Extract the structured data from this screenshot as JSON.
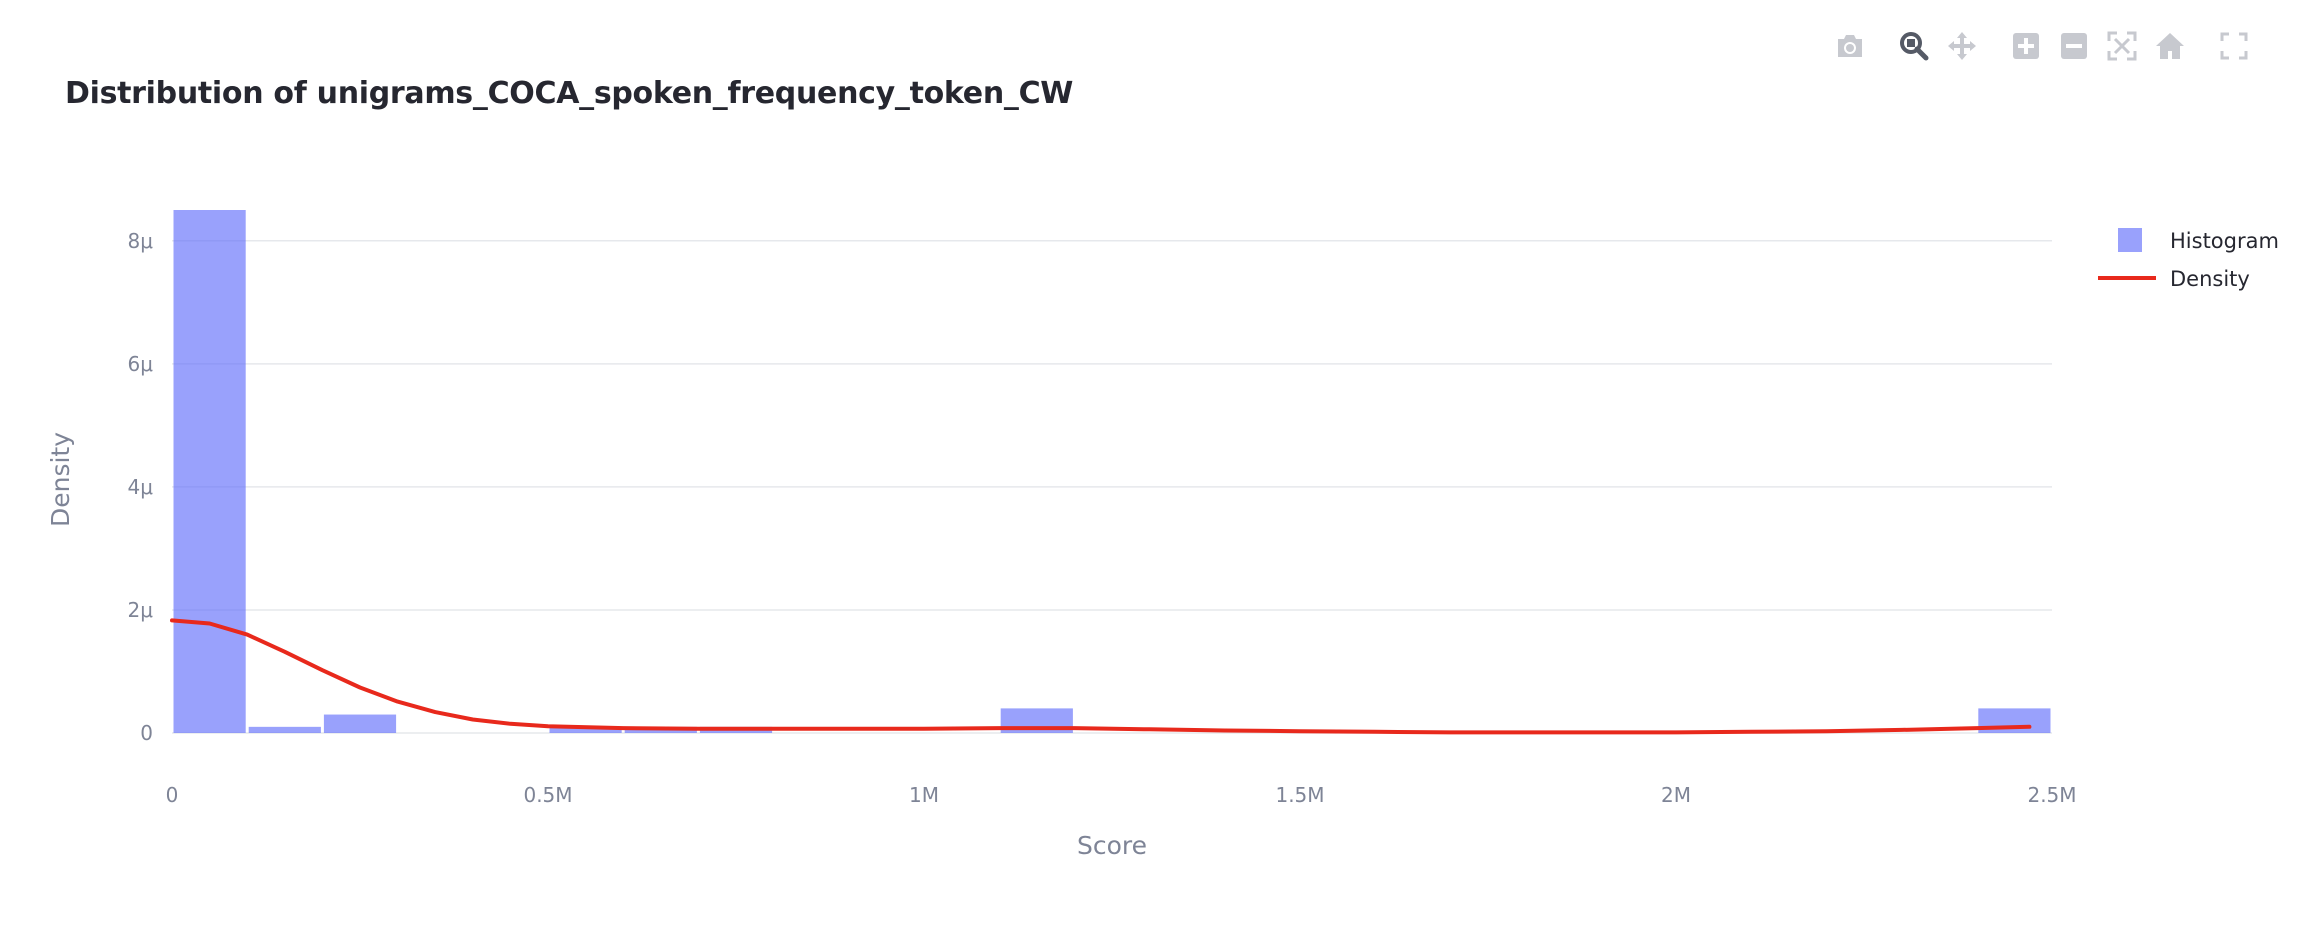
{
  "title": "Distribution of unigrams_COCA_spoken_frequency_token_CW",
  "modebar": [
    {
      "name": "camera-icon",
      "label": "Download plot as a png",
      "active": false
    },
    {
      "name": "zoom-icon",
      "label": "Zoom",
      "active": true
    },
    {
      "name": "pan-icon",
      "label": "Pan",
      "active": false
    },
    {
      "name": "zoom-in-icon",
      "label": "Zoom in",
      "active": false
    },
    {
      "name": "zoom-out-icon",
      "label": "Zoom out",
      "active": false
    },
    {
      "name": "autoscale-icon",
      "label": "Autoscale",
      "active": false
    },
    {
      "name": "reset-axes-icon",
      "label": "Reset axes",
      "active": false
    },
    {
      "name": "fullscreen-icon",
      "label": "Fullscreen",
      "active": false
    }
  ],
  "chart_data": {
    "type": "bar",
    "xlabel": "Score",
    "ylabel": "Density",
    "xlim": [
      0,
      2500000
    ],
    "ylim": [
      0,
      8.5e-06
    ],
    "x_ticks": [
      {
        "value": 0,
        "label": "0"
      },
      {
        "value": 500000,
        "label": "0.5M"
      },
      {
        "value": 1000000,
        "label": "1M"
      },
      {
        "value": 1500000,
        "label": "1.5M"
      },
      {
        "value": 2000000,
        "label": "2M"
      },
      {
        "value": 2500000,
        "label": "2.5M"
      }
    ],
    "y_ticks": [
      {
        "value": 0,
        "label": "0"
      },
      {
        "value": 2e-06,
        "label": "2μ"
      },
      {
        "value": 4e-06,
        "label": "4μ"
      },
      {
        "value": 6e-06,
        "label": "6μ"
      },
      {
        "value": 8e-06,
        "label": "8μ"
      }
    ],
    "grid": true,
    "legend_position": "top-right",
    "series": [
      {
        "name": "Histogram",
        "type": "bar",
        "color": "#636efa",
        "opacity": 0.65,
        "bin_width": 100000,
        "bins": [
          {
            "start": 0,
            "value": 8.5e-06
          },
          {
            "start": 100000,
            "value": 1e-07
          },
          {
            "start": 200000,
            "value": 3e-07
          },
          {
            "start": 500000,
            "value": 1e-07
          },
          {
            "start": 600000,
            "value": 1e-07
          },
          {
            "start": 700000,
            "value": 1e-07
          },
          {
            "start": 1100000,
            "value": 4e-07
          },
          {
            "start": 2400000,
            "value": 4e-07
          }
        ]
      },
      {
        "name": "Density",
        "type": "line",
        "color": "#e8291c",
        "x": [
          0,
          50000,
          100000,
          150000,
          200000,
          250000,
          300000,
          350000,
          400000,
          450000,
          500000,
          600000,
          700000,
          800000,
          900000,
          1000000,
          1100000,
          1200000,
          1300000,
          1400000,
          1500000,
          1600000,
          1700000,
          1800000,
          1900000,
          2000000,
          2100000,
          2200000,
          2300000,
          2400000,
          2470000
        ],
        "y": [
          1.83e-06,
          1.78e-06,
          1.6e-06,
          1.32e-06,
          1.02e-06,
          7.4e-07,
          5.1e-07,
          3.4e-07,
          2.2e-07,
          1.5e-07,
          1.1e-07,
          8e-08,
          7e-08,
          7e-08,
          7e-08,
          7e-08,
          8e-08,
          8e-08,
          6e-08,
          4e-08,
          3e-08,
          2e-08,
          1e-08,
          1e-08,
          1e-08,
          1e-08,
          2e-08,
          3e-08,
          5e-08,
          8e-08,
          1e-07
        ]
      }
    ]
  }
}
